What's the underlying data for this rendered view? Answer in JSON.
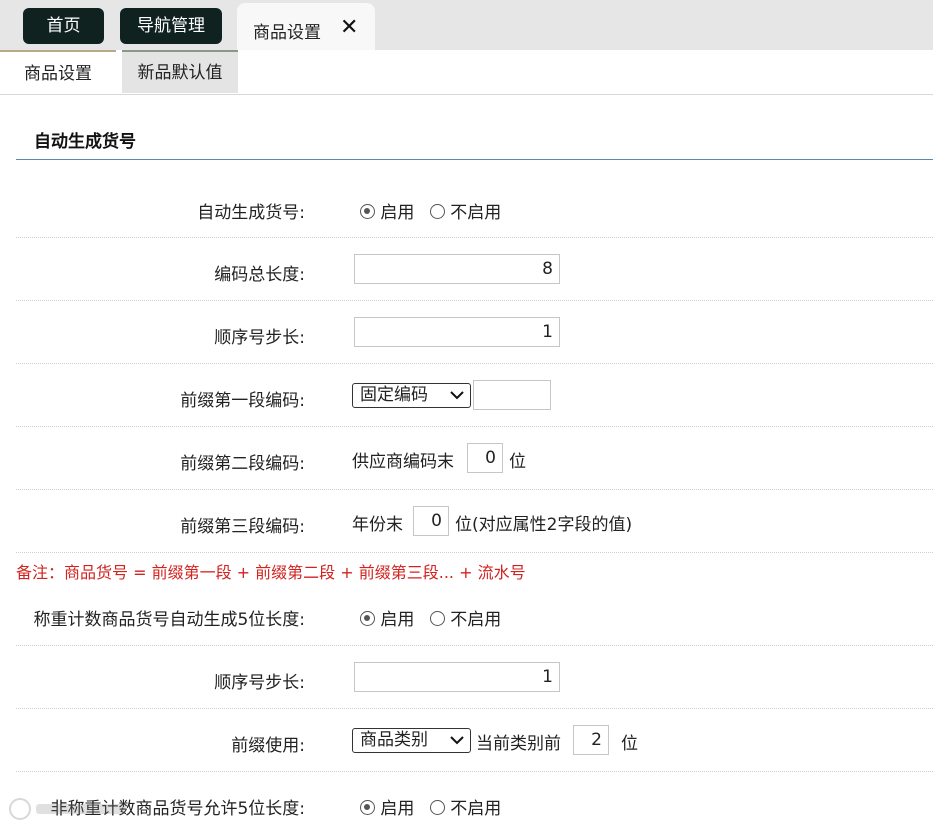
{
  "tabs": {
    "home": "首页",
    "nav_manage": "导航管理",
    "product_settings": "商品设置",
    "close_glyph": "✕"
  },
  "subtabs": [
    "商品设置",
    "新品默认值"
  ],
  "section_title": "自动生成货号",
  "rows": {
    "auto_gen": {
      "label": "自动生成货号:",
      "on": "启用",
      "off": "不启用",
      "selected": "启用"
    },
    "code_len": {
      "label": "编码总长度:",
      "value": "8"
    },
    "seq_step": {
      "label": "顺序号步长:",
      "value": "1"
    },
    "prefix1": {
      "label": "前缀第一段编码:",
      "select": "固定编码",
      "value": ""
    },
    "prefix2": {
      "label": "前缀第二段编码:",
      "before": "供应商编码末",
      "value": "0",
      "after": "位"
    },
    "prefix3": {
      "label": "前缀第三段编码:",
      "before": "年份末",
      "value": "0",
      "after": "位(对应属性2字段的值)"
    },
    "weigh_auto": {
      "label": "称重计数商品货号自动生成5位长度:",
      "on": "启用",
      "off": "不启用",
      "selected": "启用"
    },
    "seq_step2": {
      "label": "顺序号步长:",
      "value": "1"
    },
    "prefix_use": {
      "label": "前缀使用:",
      "select": "商品类别",
      "before": "当前类别前",
      "value": "2",
      "after": "位"
    },
    "nonweigh": {
      "label": "非称重计数商品货号允许5位长度:",
      "on": "启用",
      "off": "不启用",
      "selected": "启用"
    }
  },
  "note": "备注：商品货号 = 前缀第一段 + 前缀第二段 + 前缀第三段... + 流水号",
  "colors": {
    "dark_tab": "#0f2220",
    "note": "#d2231f",
    "section_line": "#5a8aa8"
  }
}
